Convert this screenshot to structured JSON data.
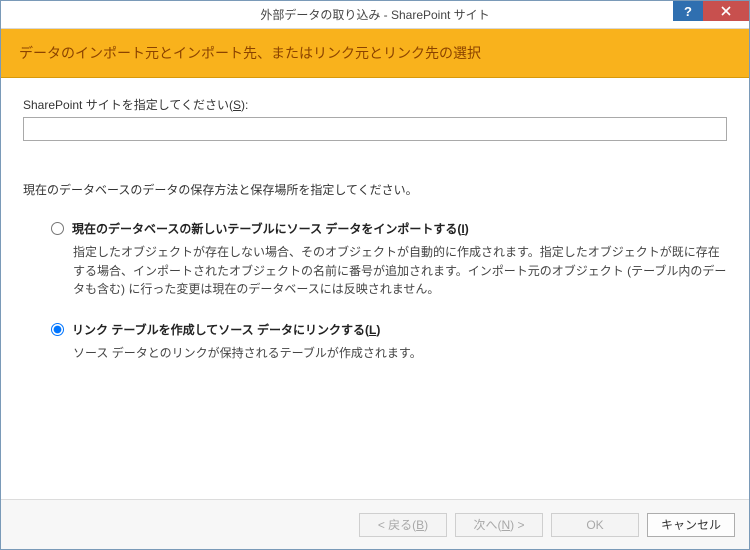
{
  "titlebar": {
    "title": "外部データの取り込み - SharePoint サイト",
    "help_symbol": "?",
    "close_symbol": "✕"
  },
  "banner": {
    "heading": "データのインポート元とインポート先、またはリンク元とリンク先の選択"
  },
  "content": {
    "site_label_pre": "SharePoint サイトを指定してください(",
    "site_label_key": "S",
    "site_label_post": "):",
    "site_value": "",
    "instruction": "現在のデータベースのデータの保存方法と保存場所を指定してください。",
    "options": [
      {
        "label_pre": "現在のデータベースの新しいテーブルにソース データをインポートする(",
        "label_key": "I",
        "label_post": ")",
        "desc": "指定したオブジェクトが存在しない場合、そのオブジェクトが自動的に作成されます。指定したオブジェクトが既に存在する場合、インポートされたオブジェクトの名前に番号が追加されます。インポート元のオブジェクト (テーブル内のデータも含む) に行った変更は現在のデータベースには反映されません。",
        "checked": false
      },
      {
        "label_pre": "リンク テーブルを作成してソース データにリンクする(",
        "label_key": "L",
        "label_post": ")",
        "desc": "ソース データとのリンクが保持されるテーブルが作成されます。",
        "checked": true
      }
    ]
  },
  "footer": {
    "back_pre": "< 戻る(",
    "back_key": "B",
    "back_post": ")",
    "next_pre": "次へ(",
    "next_key": "N",
    "next_post": ") >",
    "ok": "OK",
    "cancel": "キャンセル"
  }
}
